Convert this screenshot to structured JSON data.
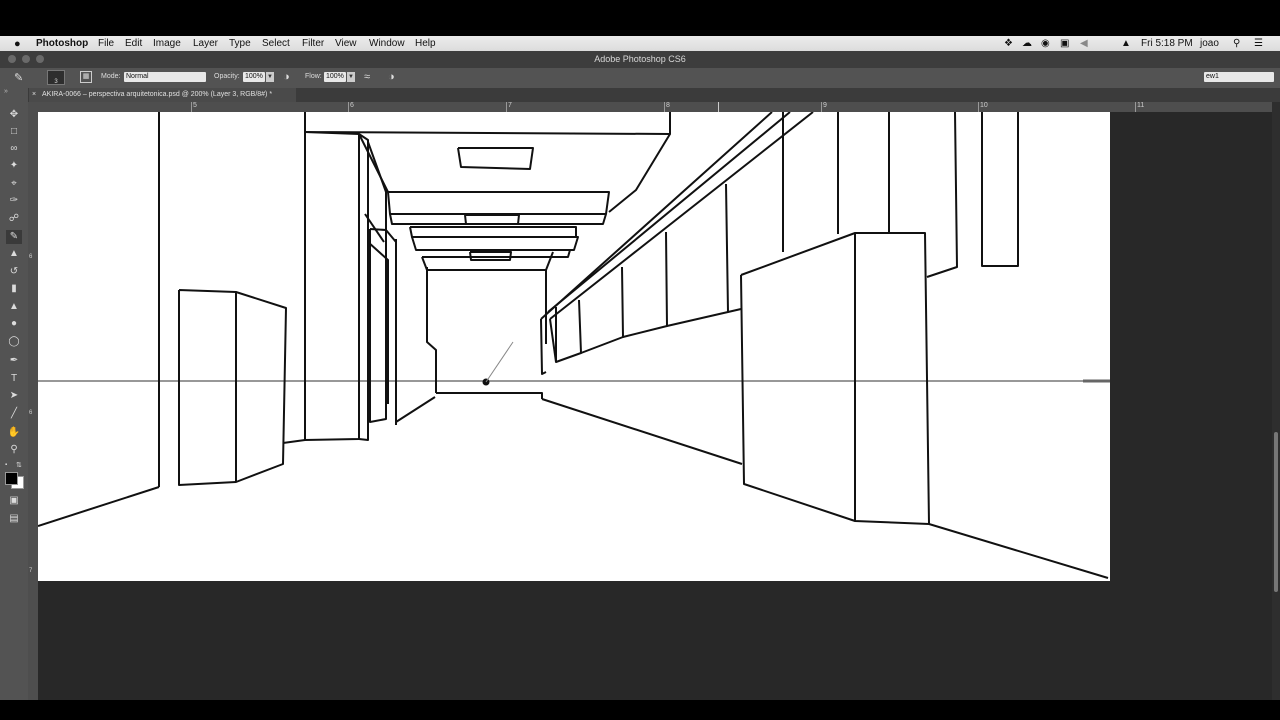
{
  "menubar": {
    "app_name": "Photoshop",
    "items": [
      "File",
      "Edit",
      "Image",
      "Layer",
      "Type",
      "Select",
      "Filter",
      "View",
      "Window",
      "Help"
    ],
    "clock": "Fri 5:18 PM",
    "user": "joao"
  },
  "window": {
    "title": "Adobe Photoshop CS6"
  },
  "options_bar": {
    "brush_size": "3",
    "mode_label": "Mode:",
    "mode_value": "Normal",
    "opacity_label": "Opacity:",
    "opacity_value": "100%",
    "flow_label": "Flow:",
    "flow_value": "100%",
    "workspace_value": "ew1"
  },
  "document": {
    "tab_label": "AKIRA-0066 – perspectiva arquitetonica.psd @ 200% (Layer 3, RGB/8#) *"
  },
  "ruler": {
    "top_labels": [
      "5",
      "6",
      "7",
      "8",
      "9",
      "10",
      "11"
    ],
    "left_labels": [
      "6",
      "6",
      "7"
    ]
  },
  "tools": [
    "move-tool",
    "marquee-tool",
    "lasso-tool",
    "magic-wand-tool",
    "crop-tool",
    "eyedropper-tool",
    "healing-tool",
    "brush-tool",
    "stamp-tool",
    "history-brush-tool",
    "eraser-tool",
    "paint-bucket-tool",
    "blur-tool",
    "dodge-tool",
    "pen-tool",
    "type-tool",
    "path-selection-tool",
    "line-tool",
    "hand-tool",
    "zoom-tool"
  ],
  "colors": {
    "foreground": "#000000",
    "background": "#ffffff",
    "ui_dark": "#535353",
    "workspace": "#282828"
  }
}
